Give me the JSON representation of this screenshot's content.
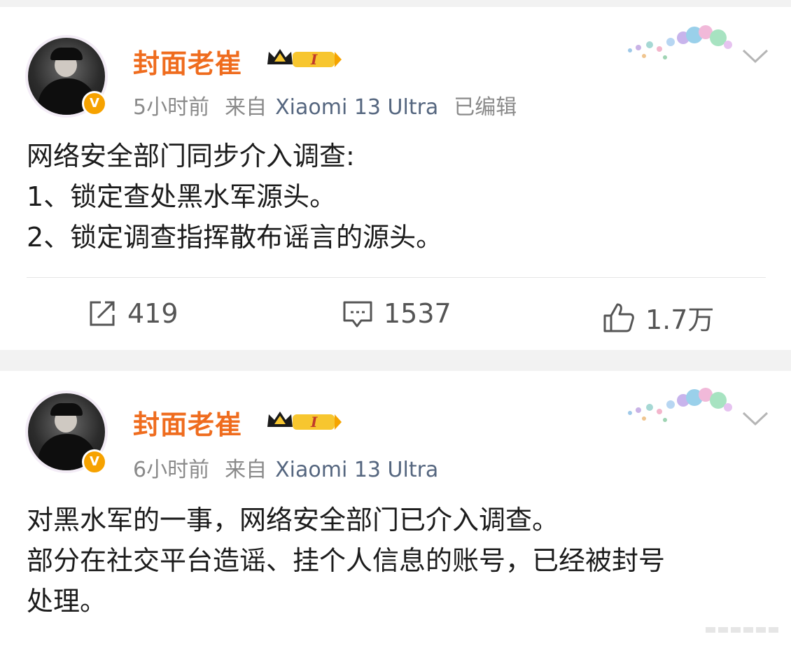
{
  "posts": [
    {
      "username": "封面老崔",
      "member_level": "I",
      "time": "5小时前",
      "source_prefix": "来自",
      "device": "Xiaomi 13 Ultra",
      "edited": "已编辑",
      "lines": [
        "网络安全部门同步介入调查:",
        "1、锁定查处黑水军源头。",
        "2、锁定调查指挥散布谣言的源头。"
      ],
      "actions": {
        "repost": "419",
        "comment": "1537",
        "like": "1.7万"
      }
    },
    {
      "username": "封面老崔",
      "member_level": "I",
      "time": "6小时前",
      "source_prefix": "来自",
      "device": "Xiaomi 13 Ultra",
      "lines": [
        "对黑水军的一事，网络安全部门已介入调查。",
        "部分在社交平台造谣、挂个人信息的账号，已经被封号",
        "处理。"
      ]
    }
  ],
  "colors": {
    "username": "#ef6c1e",
    "meta": "#8a8a8a",
    "device": "#55667f",
    "verified": "#f6a200"
  },
  "icons": [
    "chevron-down-icon",
    "repost-icon",
    "comment-icon",
    "like-icon",
    "crown-icon",
    "verified-icon"
  ]
}
